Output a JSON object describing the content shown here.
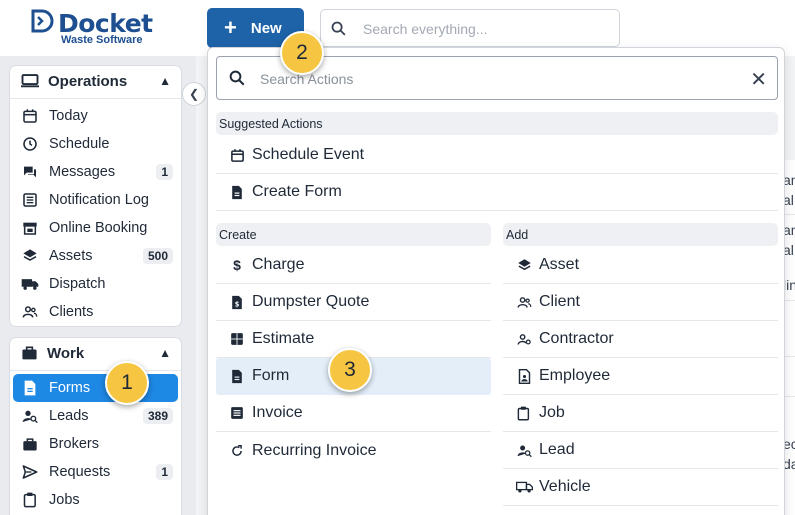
{
  "brand": {
    "name": "Docket",
    "subtitle": "Waste Software",
    "color": "#1d4f91"
  },
  "header": {
    "new_label": "New",
    "search_placeholder": "Search everything..."
  },
  "sidebar": {
    "operations": {
      "title": "Operations",
      "items": [
        {
          "label": "Today",
          "icon": "calendar-icon",
          "badge": ""
        },
        {
          "label": "Schedule",
          "icon": "clock-icon",
          "badge": ""
        },
        {
          "label": "Messages",
          "icon": "chat-icon",
          "badge": "1"
        },
        {
          "label": "Notification Log",
          "icon": "list-icon",
          "badge": ""
        },
        {
          "label": "Online Booking",
          "icon": "store-icon",
          "badge": ""
        },
        {
          "label": "Assets",
          "icon": "layers-icon",
          "badge": "500"
        },
        {
          "label": "Dispatch",
          "icon": "truck-icon",
          "badge": ""
        },
        {
          "label": "Clients",
          "icon": "users-icon",
          "badge": ""
        }
      ]
    },
    "work": {
      "title": "Work",
      "items": [
        {
          "label": "Forms",
          "icon": "file-icon",
          "badge": "",
          "active": true
        },
        {
          "label": "Leads",
          "icon": "user-search-icon",
          "badge": "389"
        },
        {
          "label": "Brokers",
          "icon": "briefcase-icon",
          "badge": ""
        },
        {
          "label": "Requests",
          "icon": "send-icon",
          "badge": "1"
        },
        {
          "label": "Jobs",
          "icon": "clipboard-icon",
          "badge": ""
        }
      ]
    }
  },
  "dropdown": {
    "search_placeholder": "Search Actions",
    "suggested_title": "Suggested Actions",
    "suggested": [
      {
        "label": "Schedule Event",
        "icon": "calendar-icon"
      },
      {
        "label": "Create Form",
        "icon": "file-icon"
      }
    ],
    "create_title": "Create",
    "create": [
      {
        "label": "Charge",
        "icon": "dollar-icon"
      },
      {
        "label": "Dumpster Quote",
        "icon": "file-dollar-icon"
      },
      {
        "label": "Estimate",
        "icon": "calculator-icon"
      },
      {
        "label": "Form",
        "icon": "file-icon",
        "highlighted": true
      },
      {
        "label": "Invoice",
        "icon": "invoice-icon"
      },
      {
        "label": "Recurring Invoice",
        "icon": "refresh-icon"
      }
    ],
    "add_title": "Add",
    "add": [
      {
        "label": "Asset",
        "icon": "layers-icon"
      },
      {
        "label": "Client",
        "icon": "users-icon"
      },
      {
        "label": "Contractor",
        "icon": "user-gear-icon"
      },
      {
        "label": "Employee",
        "icon": "id-icon"
      },
      {
        "label": "Job",
        "icon": "clipboard-icon"
      },
      {
        "label": "Lead",
        "icon": "user-search-icon"
      },
      {
        "label": "Vehicle",
        "icon": "truck-icon"
      }
    ]
  },
  "background_fragments": [
    "an",
    "al",
    "an",
    "al",
    "lin",
    "ec",
    "da"
  ],
  "callouts": [
    "1",
    "2",
    "3"
  ]
}
